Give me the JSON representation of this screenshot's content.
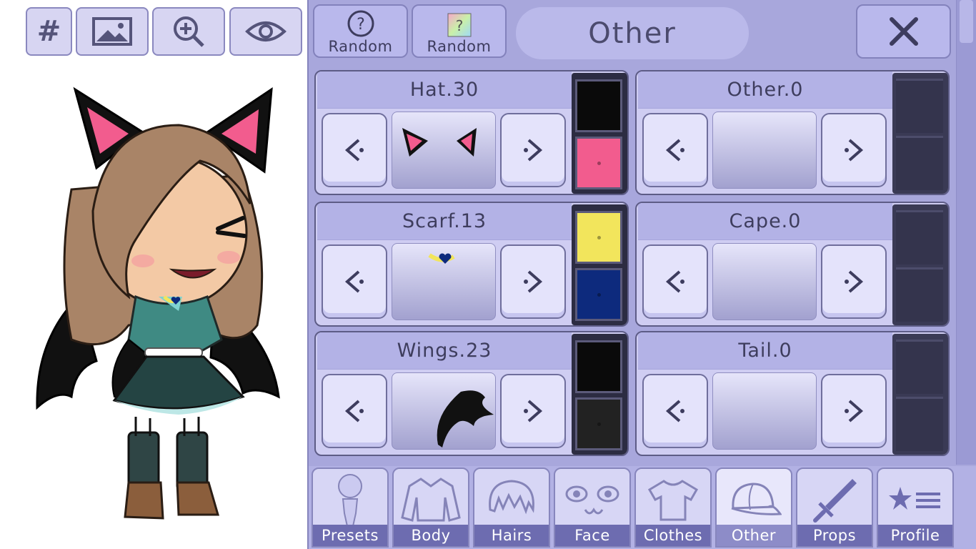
{
  "toolbar": {
    "grid_icon": "#"
  },
  "header": {
    "random1_label": "Random",
    "random2_label": "Random",
    "title": "Other",
    "close_label": "X"
  },
  "slots": [
    {
      "title": "Hat.30",
      "color1": "#0a0a0a",
      "color2": "#f25c8e"
    },
    {
      "title": "Other.0"
    },
    {
      "title": "Scarf.13",
      "color1": "#f2e55c",
      "color2": "#0d2a7d"
    },
    {
      "title": "Cape.0"
    },
    {
      "title": "Wings.23",
      "color1": "#0a0a0a",
      "color2": "#222222"
    },
    {
      "title": "Tail.0"
    }
  ],
  "tabs": [
    {
      "label": "Presets"
    },
    {
      "label": "Body"
    },
    {
      "label": "Hairs"
    },
    {
      "label": "Face"
    },
    {
      "label": "Clothes"
    },
    {
      "label": "Other"
    },
    {
      "label": "Props"
    },
    {
      "label": "Profile"
    }
  ],
  "theme": {
    "panel": "#a8a7dc",
    "accent": "#6d6cb0"
  }
}
